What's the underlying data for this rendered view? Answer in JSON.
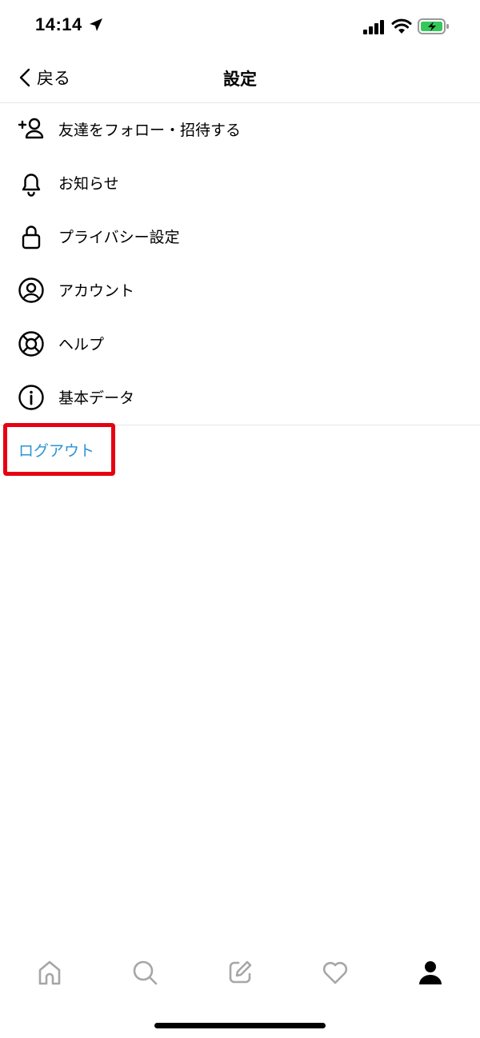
{
  "status_bar": {
    "time": "14:14"
  },
  "header": {
    "back_label": "戻る",
    "title": "設定"
  },
  "settings": [
    {
      "label": "友達をフォロー・招待する",
      "icon": "add-person-icon"
    },
    {
      "label": "お知らせ",
      "icon": "bell-icon"
    },
    {
      "label": "プライバシー設定",
      "icon": "lock-icon"
    },
    {
      "label": "アカウント",
      "icon": "account-circle-icon"
    },
    {
      "label": "ヘルプ",
      "icon": "lifebuoy-icon"
    },
    {
      "label": "基本データ",
      "icon": "info-icon"
    }
  ],
  "logout": {
    "label": "ログアウト",
    "color": "#2a93d5",
    "highlight_color": "#e60012"
  },
  "tabs": [
    {
      "name": "home",
      "icon": "home-icon",
      "active": false
    },
    {
      "name": "search",
      "icon": "search-icon",
      "active": false
    },
    {
      "name": "compose",
      "icon": "compose-icon",
      "active": false
    },
    {
      "name": "activity",
      "icon": "heart-icon",
      "active": false
    },
    {
      "name": "profile",
      "icon": "profile-icon",
      "active": true
    }
  ]
}
